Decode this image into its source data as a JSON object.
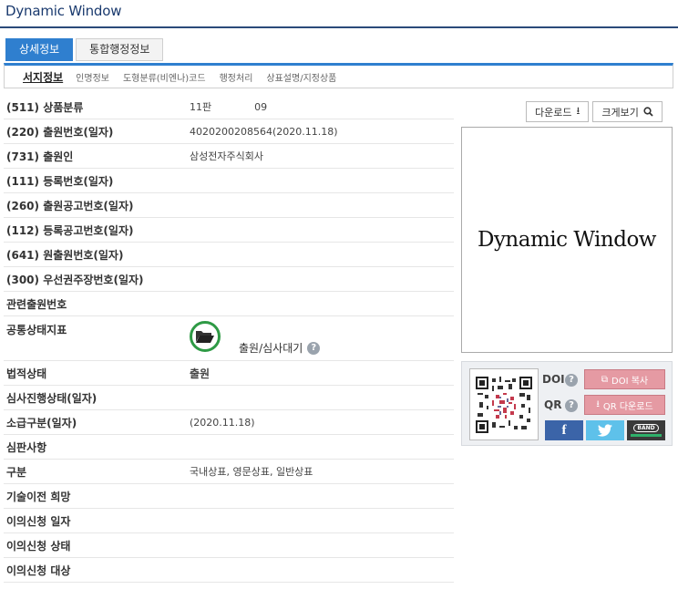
{
  "page_title": "Dynamic Window",
  "top_tabs": [
    {
      "label": "상세정보",
      "active": true
    },
    {
      "label": "통합행정정보",
      "active": false
    }
  ],
  "sub_tabs": [
    {
      "label": "서지정보",
      "active": true
    },
    {
      "label": "인명정보"
    },
    {
      "label": "도형분류(비엔나)코드"
    },
    {
      "label": "행정처리"
    },
    {
      "label": "상표설명/지정상품"
    }
  ],
  "rows": [
    {
      "label": "(511) 상품분류",
      "value": "11판",
      "value2": "09"
    },
    {
      "label": "(220) 출원번호(일자)",
      "value": "4020200208564(2020.11.18)"
    },
    {
      "label": "(731) 출원인",
      "value": "삼성전자주식회사"
    },
    {
      "label": "(111) 등록번호(일자)",
      "value": ""
    },
    {
      "label": "(260) 출원공고번호(일자)",
      "value": ""
    },
    {
      "label": "(112) 등록공고번호(일자)",
      "value": ""
    },
    {
      "label": "(641) 원출원번호(일자)",
      "value": ""
    },
    {
      "label": "(300) 우선권주장번호(일자)",
      "value": ""
    },
    {
      "label": "관련출원번호",
      "value": ""
    },
    {
      "label": "공통상태지표",
      "status_text": "출원/심사대기",
      "status_icon": "folder-open-icon"
    },
    {
      "label": "법적상태",
      "value": "출원"
    },
    {
      "label": "심사진행상태(일자)",
      "value": ""
    },
    {
      "label": "소급구분(일자)",
      "value": "(2020.11.18)"
    },
    {
      "label": "심판사항",
      "value": ""
    },
    {
      "label": "구분",
      "value": "국내상표, 영문상표, 일반상표"
    },
    {
      "label": "기술이전 희망",
      "value": ""
    },
    {
      "label": "이의신청 일자",
      "value": ""
    },
    {
      "label": "이의신청 상태",
      "value": ""
    },
    {
      "label": "이의신청 대상",
      "value": ""
    }
  ],
  "buttons": {
    "download": "다운로드",
    "zoom": "크게보기"
  },
  "preview_text": "Dynamic Window",
  "share": {
    "doi_label": "DOI",
    "qr_label": "QR",
    "doi_copy": "DOI 복사",
    "qr_download": "QR 다운로드",
    "band_label": "BAND"
  },
  "colors": {
    "accent": "#2f7fcf",
    "status_green": "#2e9a45",
    "pink_button": "#e59aa3",
    "facebook": "#3b64a8",
    "twitter": "#5ec1ea"
  }
}
